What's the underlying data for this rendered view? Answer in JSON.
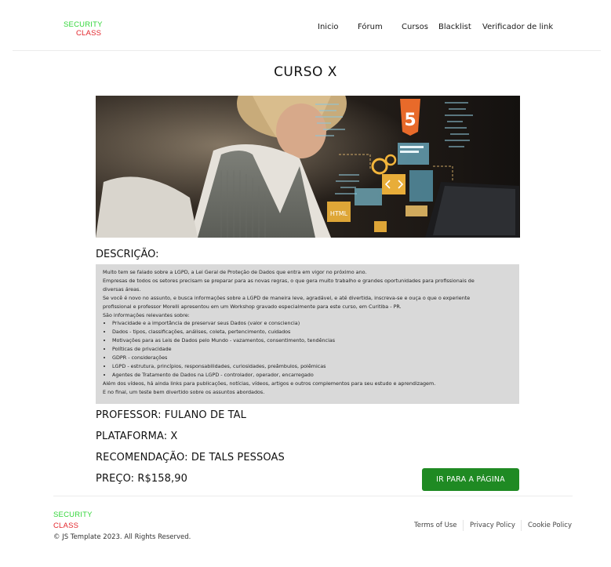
{
  "header": {
    "logo_top": "SECURITY",
    "logo_bottom": "CLASS",
    "nav": [
      "Inicio",
      "Fórum",
      "Cursos",
      "Blacklist",
      "Verificador de link"
    ]
  },
  "course": {
    "title": "CURSO X",
    "image_alt": "",
    "hero_badge": "5",
    "hero_html_tag": "HTML",
    "description_heading": "DESCRIÇÃO:",
    "description_paragraphs": [
      "Muito tem se falado sobre a LGPD, a Lei Geral de Proteção de Dados que entra em vigor no próximo ano.",
      "Empresas de todos os setores precisam se preparar para as novas regras, o que gera muito trabalho e grandes oportunidades para profissionais de",
      "diversas áreas.",
      "Se você é novo no assunto, e busca informações sobre a LGPD de maneira leve, agradável, e até divertida, inscreva-se e ouça o que o experiente",
      "profissional e professor Morelli apresentou em um Workshop gravado especialmente para este curso, em Curitiba - PR.",
      "São informações relevantes sobre:"
    ],
    "description_bullets": [
      "Privacidade e a importância de preservar seus Dados (valor e consciencia)",
      "Dados - tipos, classificações, análises, coleta, pertencimento, cuidados",
      "Motivações para as Leis de Dados pelo Mundo - vazamentos, consentimento, tendências",
      "Políticas de privacidade",
      "GDPR - considerações",
      "LGPD - estrutura, princípios, responsabilidades, curiosidades, preâmbulos, polêmicas",
      "Agentes de Tratamento de Dados na LGPD - controlador, operador, encarregado"
    ],
    "description_closing": [
      "Além dos vídeos, há ainda links para publicações, notícias, vídeos, artigos e outros complementos para seu estudo e aprendizagem.",
      "E no final, um teste bem divertido sobre os assuntos abordados."
    ],
    "professor": "PROFESSOR: FULANO DE TAL",
    "platform": "PLATAFORMA: X",
    "recommendation": "RECOMENDAÇÃO: DE TALS PESSOAS",
    "price": "PREÇO: R$158,90",
    "button_label": "IR PARA A PÁGINA"
  },
  "footer": {
    "logo_top": "SECURITY",
    "logo_bottom": "CLASS",
    "copyright": "© JS Template 2023. All Rights Reserved.",
    "links": [
      "Terms of Use",
      "Privacy Policy",
      "Cookie Policy"
    ]
  },
  "colors": {
    "logo_green": "#33d63a",
    "logo_red": "#e3262c",
    "button": "#1f8a23",
    "description_bg": "#d9d9d9"
  }
}
